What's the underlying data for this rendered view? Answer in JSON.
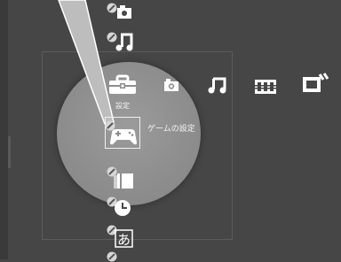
{
  "xmb": {
    "categories": [
      {
        "name": "settings",
        "icon": "toolbox-icon",
        "label": "設定"
      },
      {
        "name": "photo",
        "icon": "camera-icon"
      },
      {
        "name": "music",
        "icon": "music-note-icon"
      },
      {
        "name": "video",
        "icon": "film-icon"
      },
      {
        "name": "game",
        "icon": "game-icon"
      }
    ],
    "settings_items": [
      {
        "icon": "camera-settings-icon"
      },
      {
        "icon": "music-settings-icon"
      },
      {
        "icon": "gamepad-icon",
        "label": "ゲームの設定",
        "selected": true
      },
      {
        "icon": "video-settings-icon"
      },
      {
        "icon": "clock-icon"
      },
      {
        "icon": "language-icon",
        "glyph": "あ"
      },
      {
        "icon": "settings-item-icon"
      }
    ]
  },
  "colors": {
    "background": "#464646",
    "magnifier": "#8e8e8e",
    "text": "#ffffff"
  }
}
